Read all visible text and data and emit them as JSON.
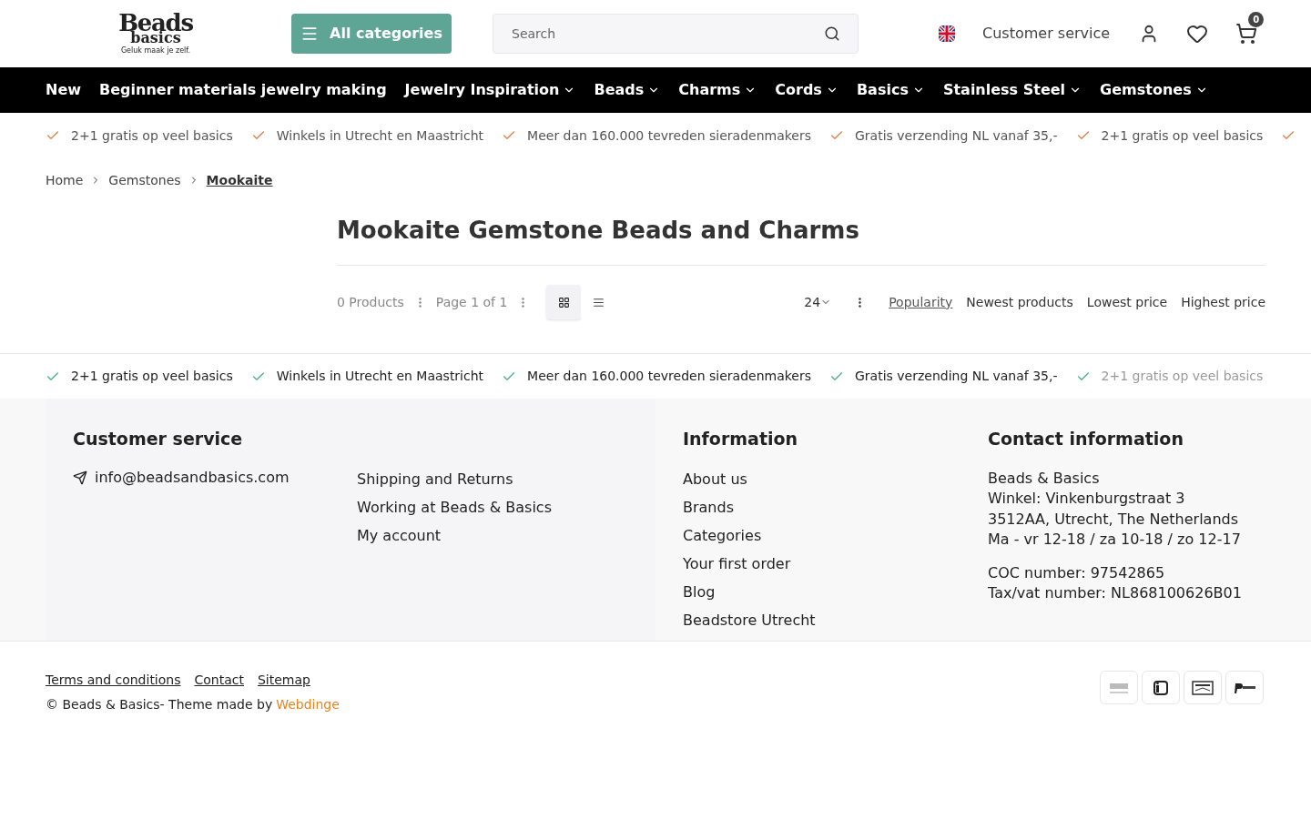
{
  "logo": {
    "line_1": "Beads",
    "line_2": "basics",
    "tagline": "Geluk maak je zelf."
  },
  "categories_button": "All categories",
  "search": {
    "placeholder": "Search"
  },
  "header_links": {
    "customer_service": "Customer service",
    "cart_count": "0"
  },
  "nav": [
    {
      "label": "New",
      "dropdown": false
    },
    {
      "label": "Beginner materials jewelry making",
      "dropdown": false
    },
    {
      "label": "Jewelry Inspiration",
      "dropdown": true
    },
    {
      "label": "Beads",
      "dropdown": true
    },
    {
      "label": "Charms",
      "dropdown": true
    },
    {
      "label": "Cords",
      "dropdown": true
    },
    {
      "label": "Basics",
      "dropdown": true
    },
    {
      "label": "Stainless Steel",
      "dropdown": true
    },
    {
      "label": "Gemstones",
      "dropdown": true
    }
  ],
  "usps_top": [
    "2+1 gratis op veel basics",
    "Winkels in Utrecht en Maastricht",
    "Meer dan 160.000 tevreden sieradenmakers",
    "Gratis verzending NL vanaf 35,-",
    "2+1 gratis op veel basics"
  ],
  "breadcrumbs": [
    {
      "label": "Home",
      "current": false
    },
    {
      "label": "Gemstones",
      "current": false
    },
    {
      "label": "Mookaite",
      "current": true
    }
  ],
  "title": "Mookaite Gemstone Beads and Charms",
  "toolbar": {
    "count": "0 Products",
    "page": "Page 1 of 1",
    "views": [
      {
        "kind": "grid",
        "selected": true
      },
      {
        "kind": "list",
        "selected": false
      }
    ],
    "per_page": "24",
    "sort": [
      {
        "label": "Popularity",
        "selected": true
      },
      {
        "label": "Newest products",
        "selected": false
      },
      {
        "label": "Lowest price",
        "selected": false
      },
      {
        "label": "Highest price",
        "selected": false
      }
    ]
  },
  "usps_bottom": [
    "2+1 gratis op veel basics",
    "Winkels in Utrecht en Maastricht",
    "Meer dan 160.000 tevreden sieradenmakers",
    "Gratis verzending NL vanaf 35,-",
    "2+1 gratis op veel basics"
  ],
  "footer": {
    "customer_service": {
      "title": "Customer service",
      "email": "info@beadsandbasics.com",
      "links": [
        "Shipping and Returns",
        "Working at Beads & Basics",
        "My account"
      ]
    },
    "information": {
      "title": "Information",
      "links": [
        "About us",
        "Brands",
        "Categories",
        "Your first order",
        "Blog",
        "Beadstore Utrecht"
      ]
    },
    "contact": {
      "title": "Contact information",
      "address": [
        "Beads & Basics",
        "Winkel: Vinkenburgstraat 3",
        "3512AA, Utrecht, The Netherlands",
        "Ma - vr 12-18 / za 10-18 / zo 12-17"
      ],
      "company": [
        "COC number: 97542865",
        "Tax/vat number: NL868100626B01"
      ]
    }
  },
  "bottom": {
    "links": [
      "Terms and conditions",
      "Contact",
      "Sitemap"
    ],
    "copyright": "© Beads & Basics- Theme made by",
    "credit": "Webdinge"
  }
}
